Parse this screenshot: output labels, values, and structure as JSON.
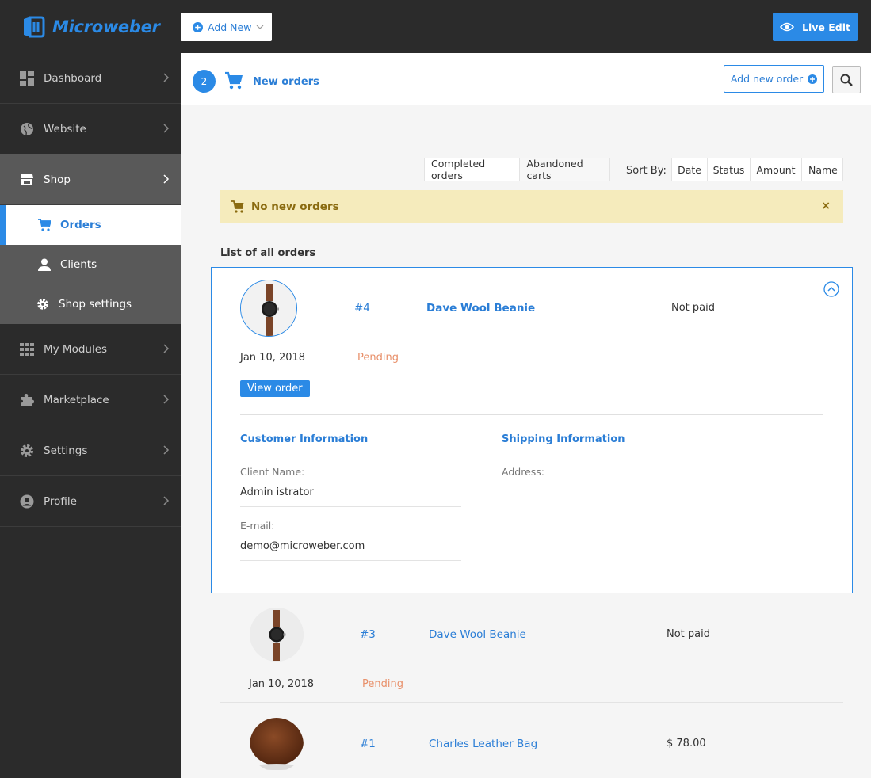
{
  "brand": {
    "name": "Microweber"
  },
  "topbar": {
    "add_new_label": "Add New",
    "live_edit_label": "Live Edit"
  },
  "sidebar": {
    "items": [
      {
        "label": "Dashboard",
        "icon": "dashboard-icon"
      },
      {
        "label": "Website",
        "icon": "globe-icon"
      },
      {
        "label": "Shop",
        "icon": "store-icon"
      },
      {
        "label": "My Modules",
        "icon": "grid-icon"
      },
      {
        "label": "Marketplace",
        "icon": "puzzle-icon"
      },
      {
        "label": "Settings",
        "icon": "gear-icon"
      },
      {
        "label": "Profile",
        "icon": "user-circle-icon"
      }
    ],
    "shop_sub": [
      {
        "label": "Orders",
        "icon": "cart-icon"
      },
      {
        "label": "Clients",
        "icon": "person-icon"
      },
      {
        "label": "Shop settings",
        "icon": "gear-icon"
      }
    ]
  },
  "header": {
    "count": "2",
    "title": "New orders",
    "add_order_label": "Add new order"
  },
  "filters": {
    "types": [
      "Completed orders",
      "Abandoned carts"
    ],
    "sort_label": "Sort By:",
    "sort": [
      "Date",
      "Status",
      "Amount",
      "Name"
    ]
  },
  "alert": {
    "text": "No new orders",
    "close": "×"
  },
  "list_title": "List of all orders",
  "orders": [
    {
      "number": "#4",
      "name": "Dave Wool Beanie",
      "payment": "Not paid",
      "date": "Jan 10, 2018",
      "status": "Pending",
      "view_label": "View order",
      "customer_heading": "Customer Information",
      "shipping_heading": "Shipping Information",
      "client_name_label": "Client Name:",
      "client_name": "Admin istrator",
      "email_label": "E-mail:",
      "email": "demo@microweber.com",
      "address_label": "Address:"
    },
    {
      "number": "#3",
      "name": "Dave Wool Beanie",
      "payment": "Not paid",
      "date": "Jan 10, 2018",
      "status": "Pending"
    },
    {
      "number": "#1",
      "name": "Charles Leather Bag",
      "payment": "$ 78.00"
    }
  ],
  "colors": {
    "accent": "#2b8ae6",
    "sidebar": "#2b2b2b",
    "pending": "#e8906a",
    "alert_bg": "#f5ebbc"
  }
}
